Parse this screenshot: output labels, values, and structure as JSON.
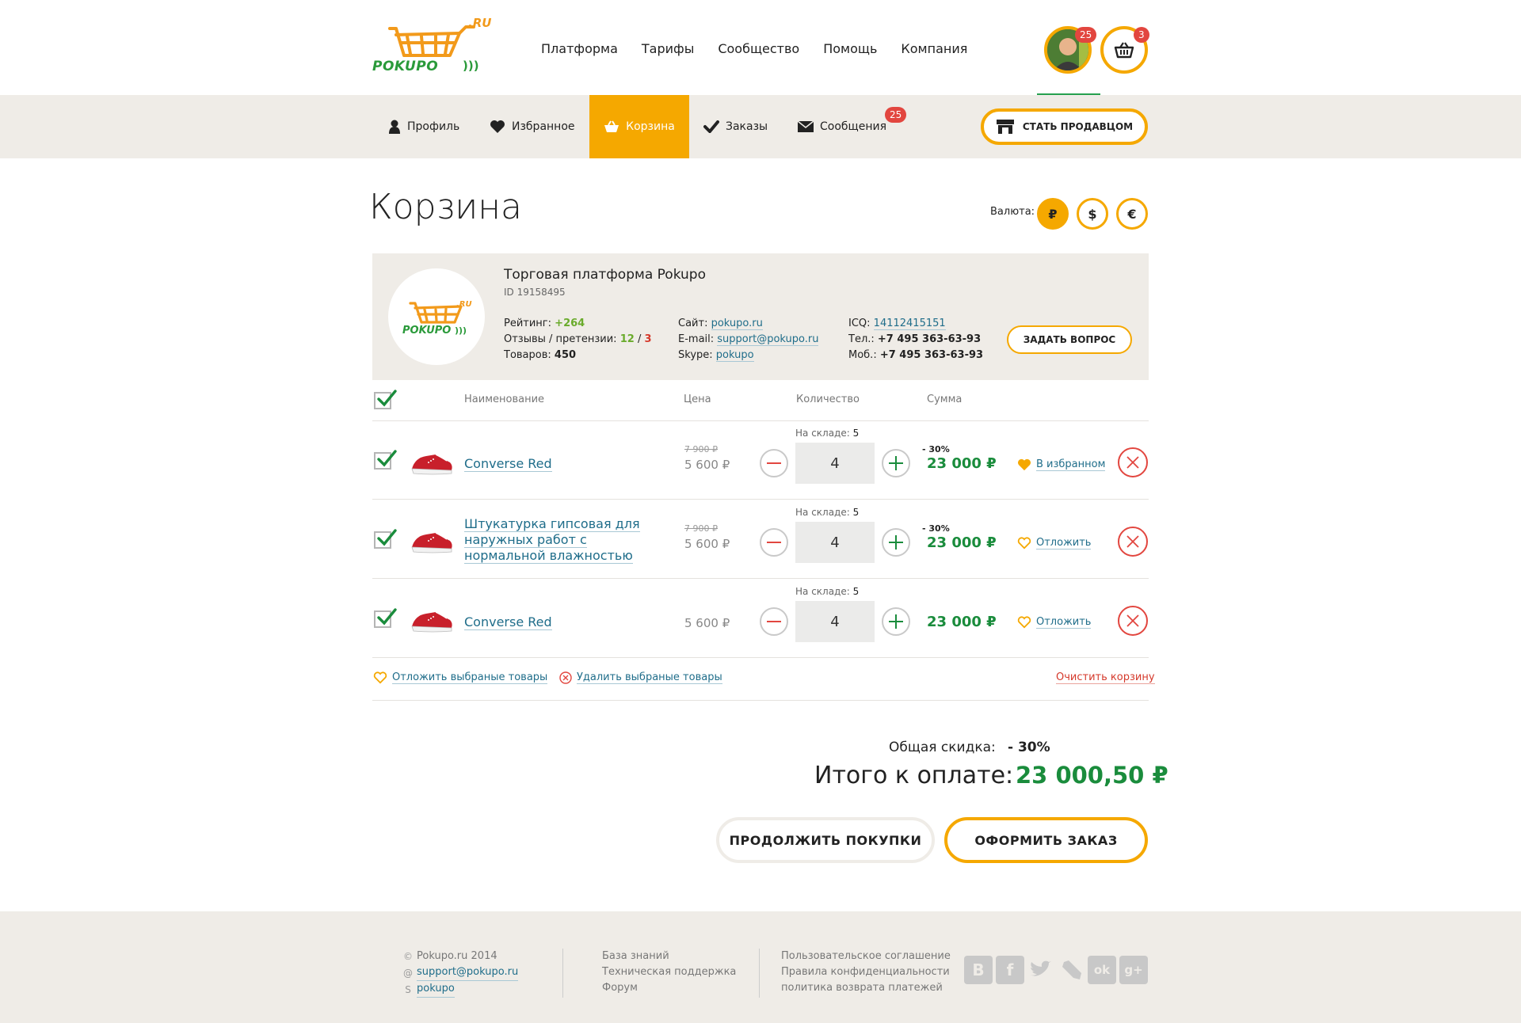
{
  "header": {
    "nav": [
      "Платформа",
      "Тарифы",
      "Сообщество",
      "Помощь",
      "Компания"
    ],
    "avatar_badge": "25",
    "cart_badge": "3",
    "logo_main": "POKUPO",
    "logo_ru": ".RU"
  },
  "subnav": {
    "items": [
      {
        "label": "Профиль",
        "icon": "user-icon"
      },
      {
        "label": "Избранное",
        "icon": "heart-icon"
      },
      {
        "label": "Корзина",
        "icon": "basket-icon"
      },
      {
        "label": "Заказы",
        "icon": "check-icon"
      },
      {
        "label": "Сообщения",
        "icon": "envelope-icon"
      }
    ],
    "messages_badge": "25",
    "become_seller": "СТАТЬ ПРОДАВЦОМ"
  },
  "page": {
    "title": "Корзина",
    "currency_label": "Валюта:",
    "currencies": [
      "₽",
      "$",
      "€"
    ]
  },
  "seller": {
    "name": "Торговая платформа Pokupo",
    "id": "ID 19158495",
    "rating_label": "Рейтинг:",
    "rating_value": "+264",
    "reviews_label": "Отзывы / претензии:",
    "reviews_good": "12",
    "reviews_sep": "/",
    "reviews_bad": "3",
    "goods_label": "Товаров:",
    "goods_value": "450",
    "site_label": "Сайт:",
    "site_value": "pokupo.ru",
    "email_label": "E-mail:",
    "email_value": "support@pokupo.ru",
    "skype_label": "Skype:",
    "skype_value": "pokupo",
    "icq_label": "ICQ:",
    "icq_value": "14112415151",
    "tel_label": "Тел.:",
    "tel_value": "+7 495 363-63-93",
    "mob_label": "Моб.:",
    "mob_value": "+7 495 363-63-93",
    "ask_button": "ЗАДАТЬ ВОПРОС"
  },
  "table": {
    "headers": {
      "name": "Наименование",
      "price": "Цена",
      "qty": "Количество",
      "sum": "Сумма"
    },
    "stock_label": "На складе:",
    "rows": [
      {
        "name": "Converse Red",
        "old_price": "7 900 ₽",
        "price": "5 600 ₽",
        "stock": "5",
        "qty": "4",
        "discount": "- 30%",
        "sum": "23 000 ₽",
        "fav": "В избранном"
      },
      {
        "name": "Штукатурка гипсовая для наружных работ с нормальной влажностью",
        "old_price": "7 900 ₽",
        "price": "5 600 ₽",
        "stock": "5",
        "qty": "4",
        "discount": "- 30%",
        "sum": "23 000 ₽",
        "fav": "Отложить"
      },
      {
        "name": "Converse Red",
        "old_price": "",
        "price": "5 600 ₽",
        "stock": "5",
        "qty": "4",
        "discount": "",
        "sum": "23 000 ₽",
        "fav": "Отложить"
      }
    ],
    "defer_selected": "Отложить выбраные товары",
    "delete_selected": "Удалить выбраные товары",
    "clear_cart": "Очистить корзину"
  },
  "totals": {
    "discount_label": "Общая скидка:",
    "discount_value": "- 30%",
    "total_label": "Итого к оплате:",
    "total_value": "23 000,50 ₽",
    "continue_button": "ПРОДОЛЖИТЬ ПОКУПКИ",
    "order_button": "ОФОРМИТЬ ЗАКАЗ"
  },
  "footer": {
    "copyright": "Pokupo.ru 2014",
    "email": "support@pokupo.ru",
    "skype": "pokupo",
    "col2": [
      "База знаний",
      "Техническая поддержка",
      "Форум"
    ],
    "col3": [
      "Пользовательское соглашение",
      "Правила конфиденциальности",
      "политика возврата платежей"
    ],
    "social": [
      {
        "icon": "vk-icon",
        "glyph": "В"
      },
      {
        "icon": "facebook-icon",
        "glyph": "f"
      },
      {
        "icon": "twitter-icon",
        "glyph": "t"
      },
      {
        "icon": "livejournal-icon",
        "glyph": "✎"
      },
      {
        "icon": "odnoklassniki-icon",
        "glyph": "ok"
      },
      {
        "icon": "googleplus-icon",
        "glyph": "g+"
      }
    ]
  },
  "colors": {
    "accent": "#f5a800",
    "green": "#1a8c3c",
    "red": "#e2463f",
    "panel": "#efece7"
  }
}
